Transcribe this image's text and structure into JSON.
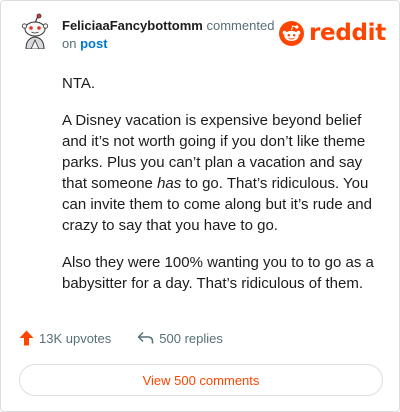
{
  "comment": {
    "username": "FeliciaaFancybottomm",
    "action": "commented",
    "on_prefix": "on",
    "on_link": "post",
    "paragraphs": [
      {
        "parts": [
          {
            "text": "NTA."
          }
        ]
      },
      {
        "parts": [
          {
            "text": "A Disney vacation is expensive beyond belief and it’s not worth going if you don’t like theme parks. Plus you can’t plan a vacation and say that someone "
          },
          {
            "text": "has",
            "italic": true
          },
          {
            "text": " to go. That’s ridiculous. You can invite them to come along but it’s rude and crazy to say that you have to go."
          }
        ]
      },
      {
        "parts": [
          {
            "text": "Also they were 100% wanting you to to go as a babysitter for a day. That’s ridiculous of them."
          }
        ]
      }
    ]
  },
  "brand": {
    "logo_text": "reddit",
    "color": "#ff4500"
  },
  "footer": {
    "upvotes": "13K upvotes",
    "replies": "500 replies",
    "upvote_icon": "upvote-arrow-icon",
    "reply_icon": "reply-arrow-icon"
  },
  "view_button": {
    "label": "View 500 comments"
  }
}
